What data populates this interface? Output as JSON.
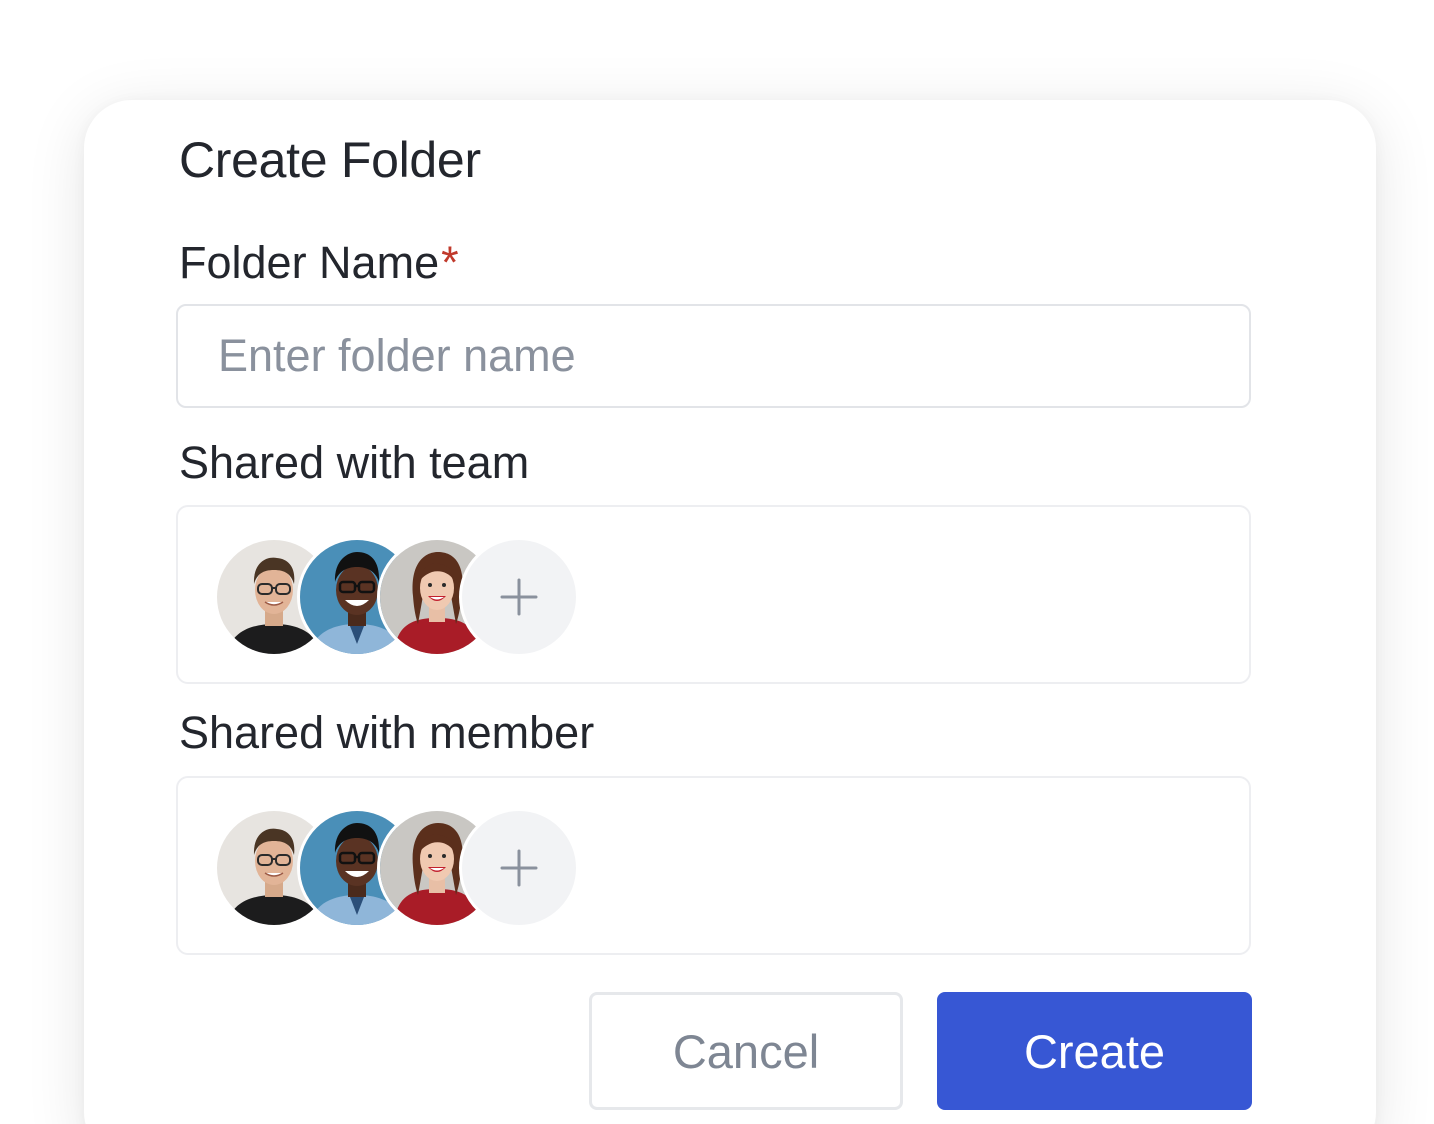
{
  "dialog": {
    "title": "Create Folder"
  },
  "folder_name": {
    "label": "Folder Name",
    "required_marker": "*",
    "placeholder": "Enter folder name",
    "value": ""
  },
  "shared_team": {
    "label": "Shared with team",
    "avatars": [
      {
        "name": "avatar-man-glasses-black-shirt"
      },
      {
        "name": "avatar-man-glasses-blue-background"
      },
      {
        "name": "avatar-woman-red-top"
      }
    ],
    "add_icon": "plus-icon"
  },
  "shared_member": {
    "label": "Shared with member",
    "avatars": [
      {
        "name": "avatar-man-glasses-black-shirt"
      },
      {
        "name": "avatar-man-glasses-blue-background"
      },
      {
        "name": "avatar-woman-red-top"
      }
    ],
    "add_icon": "plus-icon"
  },
  "actions": {
    "cancel_label": "Cancel",
    "create_label": "Create"
  },
  "colors": {
    "primary": "#3757d4",
    "required": "#c0392b",
    "placeholder": "#8a919d",
    "text": "#23262d"
  }
}
